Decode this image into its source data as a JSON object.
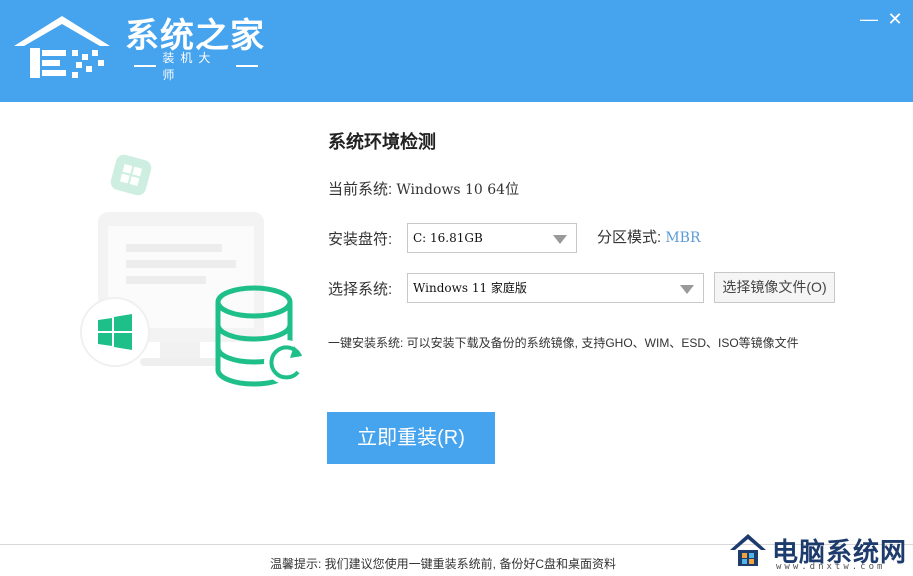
{
  "header": {
    "brand_name": "系统之家",
    "brand_sub": "装机大师",
    "minimize_label": "—",
    "close_label": "✕"
  },
  "main": {
    "section_title": "系统环境检测",
    "current_system_label": "当前系统:",
    "current_system_value": "Windows 10 64位",
    "install_drive_label": "安装盘符:",
    "install_drive_value": "C: 16.81GB",
    "partition_mode_label": "分区模式:",
    "partition_mode_value": "MBR",
    "select_system_label": "选择系统:",
    "select_system_value": "Windows 11 家庭版",
    "browse_image_button": "选择镜像文件(O)",
    "hint_text": "一键安装系统: 可以安装下载及备份的系统镜像, 支持GHO、WIM、ESD、ISO等镜像文件",
    "reinstall_button": "立即重装(R)"
  },
  "footer": {
    "tip_text": "温馨提示: 我们建议您使用一键重装系统前, 备份好C盘和桌面资料"
  },
  "watermark": {
    "name": "电脑系统网",
    "url": "www.dnxtw.com"
  },
  "colors": {
    "header_bg": "#46a3ee",
    "accent_green": "#1fbf8a",
    "link_blue": "#5d9bd5"
  }
}
